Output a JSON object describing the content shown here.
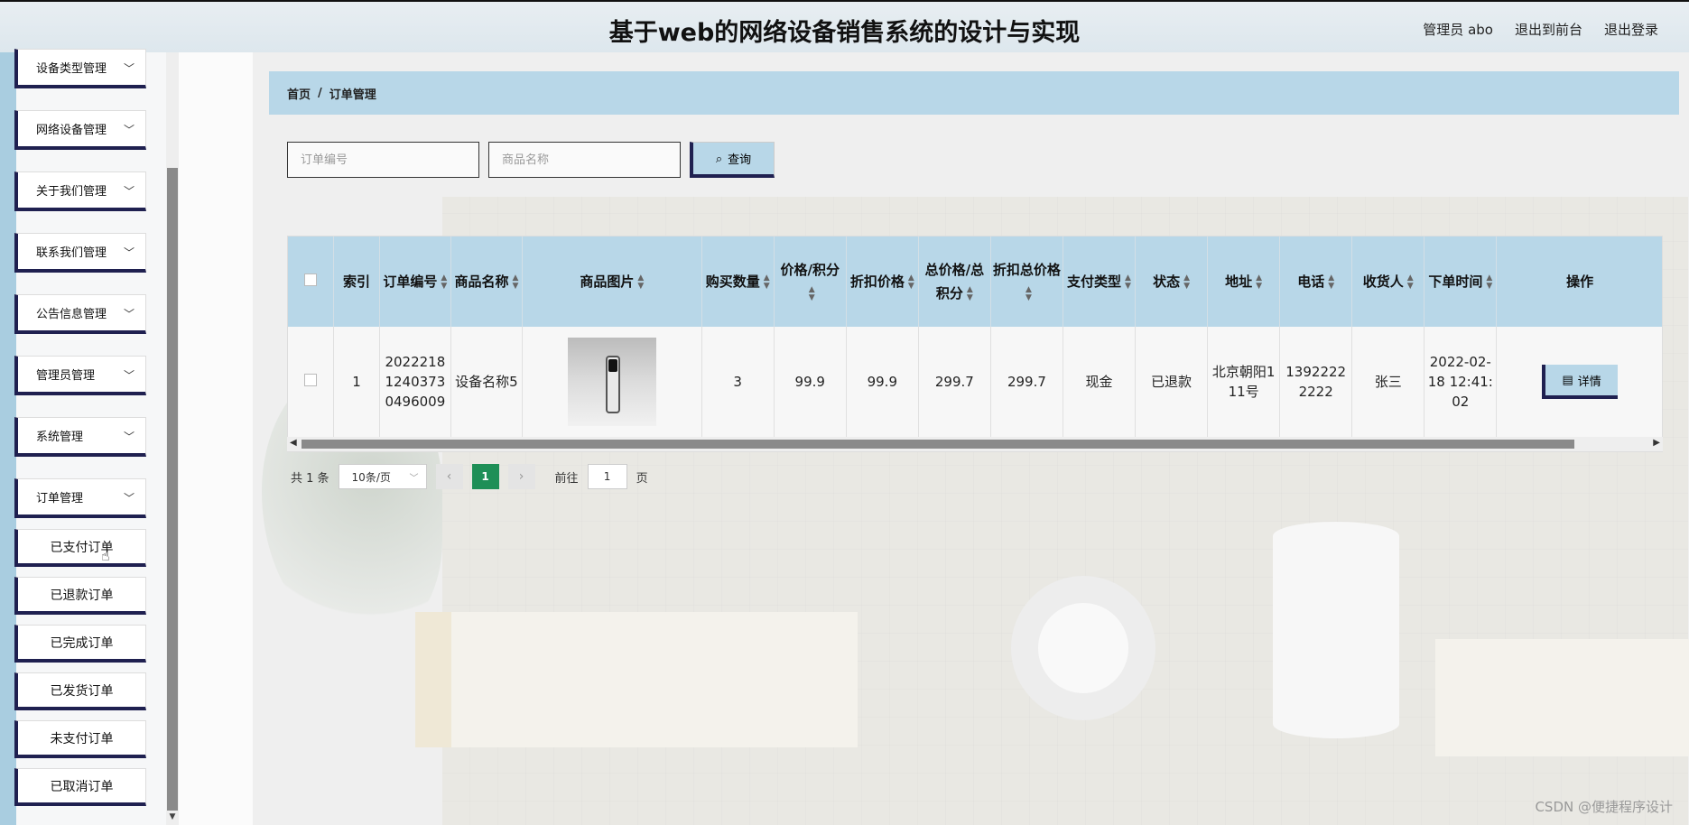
{
  "header": {
    "title": "基于web的网络设备销售系统的设计与实现",
    "nav": [
      "管理员 abo",
      "退出到前台",
      "退出登录"
    ]
  },
  "sidebar": {
    "menus": [
      "设备类型管理",
      "网络设备管理",
      "关于我们管理",
      "联系我们管理",
      "公告信息管理",
      "管理员管理",
      "系统管理",
      "订单管理"
    ],
    "submenus": [
      "已支付订单",
      "已退款订单",
      "已完成订单",
      "已发货订单",
      "未支付订单",
      "已取消订单"
    ]
  },
  "breadcrumb": {
    "home": "首页",
    "sep": "/",
    "current": "订单管理"
  },
  "search": {
    "order_placeholder": "订单编号",
    "product_placeholder": "商品名称",
    "button": "查询"
  },
  "table": {
    "columns": [
      "索引",
      "订单编号",
      "商品名称",
      "商品图片",
      "购买数量",
      "价格/积分",
      "折扣价格",
      "总价格/总积分",
      "折扣总价格",
      "支付类型",
      "状态",
      "地址",
      "电话",
      "收货人",
      "下单时间",
      "操作"
    ],
    "rows": [
      {
        "index": "1",
        "order_no": "202221812403730496009",
        "product_name": "设备名称5",
        "quantity": "3",
        "price": "99.9",
        "discount_price": "99.9",
        "total_price": "299.7",
        "discount_total": "299.7",
        "pay_type": "现金",
        "status": "已退款",
        "address": "北京朝阳111号",
        "phone": "13922222222",
        "receiver": "张三",
        "order_time": "2022-02-18 12:41:02",
        "action": "详情"
      }
    ]
  },
  "pager": {
    "total": "共 1 条",
    "page_size": "10条/页",
    "current_page": "1",
    "goto_prefix": "前往",
    "goto_value": "1",
    "goto_suffix": "页"
  },
  "watermark": "CSDN @便捷程序设计",
  "colors": {
    "accent": "#b8d7e8",
    "border_dark": "#1f2050",
    "page_active": "#1e8f57"
  }
}
